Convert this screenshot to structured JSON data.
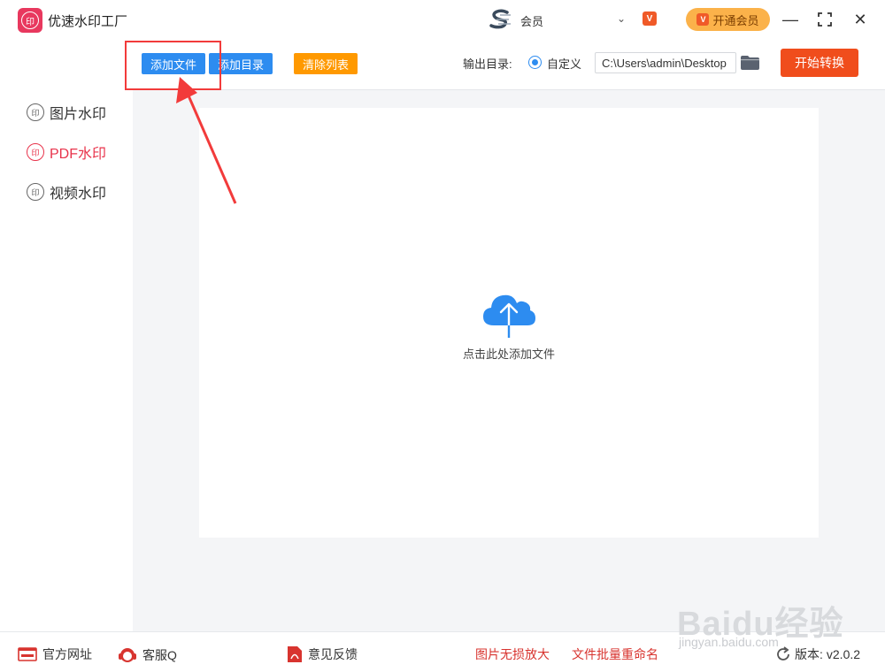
{
  "app": {
    "title": "优速水印工厂",
    "logo_glyph": "印",
    "user_name": "会员",
    "dropdown_glyph": "⌄",
    "vip_glyph": "V",
    "open_vip_label": "开通会员"
  },
  "window_controls": {
    "minimize": "—",
    "maximize": "⛶",
    "close": "✕"
  },
  "toolbar": {
    "add_file": "添加文件",
    "add_dir": "添加目录",
    "clear_list": "清除列表",
    "output_label": "输出目录:",
    "radio_label": "自定义",
    "output_path": "C:\\Users\\admin\\Desktop",
    "start_label": "开始转换"
  },
  "sidebar": {
    "items": [
      {
        "label": "图片水印",
        "icon": "watermark-icon",
        "active": false
      },
      {
        "label": "PDF水印",
        "icon": "watermark-icon",
        "active": true
      },
      {
        "label": "视频水印",
        "icon": "watermark-icon",
        "active": false
      }
    ],
    "icon_glyph": "印"
  },
  "main": {
    "drop_hint": "点击此处添加文件"
  },
  "footer": {
    "website": "官方网址",
    "support": "客服QQ",
    "feedback": "意见反馈",
    "image_enlarge": "图片无损放大",
    "batch_rename": "文件批量重命名",
    "version_label": "版本:",
    "version": "v2.0.2"
  },
  "watermark": {
    "brand": "Baidu经验",
    "sub": "jingyan.baidu.com"
  },
  "colors": {
    "accent_blue": "#2d8cf0",
    "accent_orange": "#ff9900",
    "start_red": "#f04d1c",
    "active_red": "#e8334b",
    "annotation_red": "#f23b3b"
  }
}
